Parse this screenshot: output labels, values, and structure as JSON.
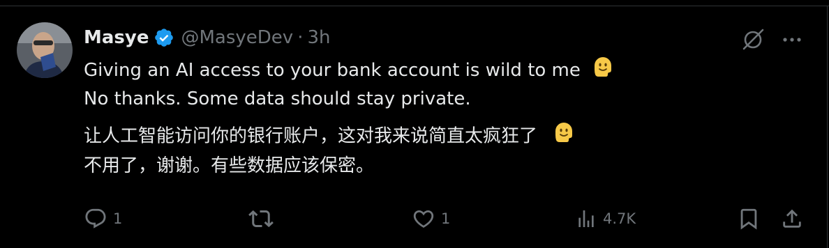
{
  "tweet": {
    "author_name": "Masye",
    "handle": "@MasyeDev",
    "separator": "·",
    "time": "3h",
    "lines_en": [
      "Giving an AI access to your bank account is wild to me",
      "No thanks. Some data should stay private."
    ],
    "lines_zh": [
      "让人工智能访问你的银行账户，这对我来说简直太疯狂了",
      "不用了，谢谢。有些数据应该保密。"
    ]
  },
  "actions": {
    "replies": "1",
    "retweets": "",
    "likes": "1",
    "views": "4.7K"
  },
  "colors": {
    "background": "#000000",
    "text": "#e7e9ea",
    "muted": "#71767b",
    "verified": "#1d9bf0",
    "divider": "#2f3336"
  },
  "icons": [
    "verified-badge-icon",
    "grok-icon",
    "more-icon",
    "reply-icon",
    "retweet-icon",
    "like-icon",
    "views-icon",
    "bookmark-icon",
    "share-icon",
    "melting-face-emoji"
  ]
}
